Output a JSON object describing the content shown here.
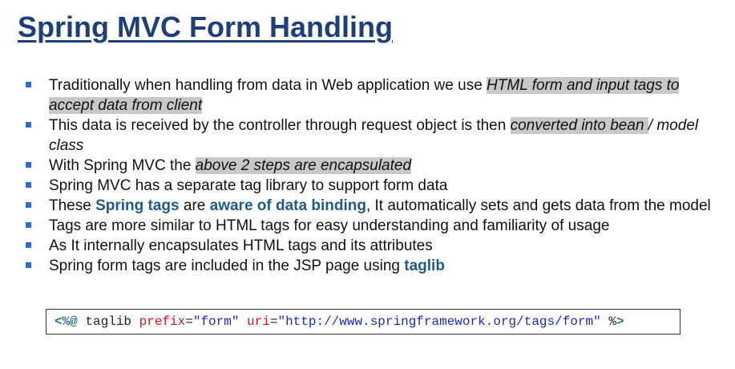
{
  "slide": {
    "title": "Spring MVC Form Handling",
    "bullets": [
      {
        "segments": [
          {
            "text": "Traditionally when handling from data in Web application we use ",
            "style": "plain"
          },
          {
            "text": "HTML form and input tags to accept data from client",
            "style": "highlight"
          }
        ]
      },
      {
        "segments": [
          {
            "text": "This data is received by the controller through request object is then ",
            "style": "plain"
          },
          {
            "text": "converted into bean ",
            "style": "highlight"
          },
          {
            "text": "/ model class",
            "style": "italic"
          }
        ]
      },
      {
        "segments": [
          {
            "text": "With Spring MVC the ",
            "style": "plain"
          },
          {
            "text": "above 2 steps are encapsulated",
            "style": "highlight"
          }
        ]
      },
      {
        "segments": [
          {
            "text": "Spring MVC has a separate tag library to support form data",
            "style": "plain"
          }
        ]
      },
      {
        "segments": [
          {
            "text": "These ",
            "style": "plain"
          },
          {
            "text": "Spring tags",
            "style": "keyword"
          },
          {
            "text": " are ",
            "style": "plain"
          },
          {
            "text": "aware of data binding",
            "style": "keyword"
          },
          {
            "text": ", It automatically sets and gets data from the model",
            "style": "plain"
          }
        ]
      },
      {
        "segments": [
          {
            "text": "Tags are more similar to HTML tags for easy understanding and familiarity of usage",
            "style": "plain"
          }
        ]
      },
      {
        "segments": [
          {
            "text": "As It internally encapsulates HTML tags and its attributes",
            "style": "plain"
          }
        ]
      },
      {
        "segments": [
          {
            "text": "Spring form tags are included in the JSP page using ",
            "style": "plain"
          },
          {
            "text": "taglib",
            "style": "keyword"
          }
        ]
      }
    ],
    "code": {
      "open": "<%@",
      "directive": " taglib ",
      "attr1_name": "prefix",
      "eq1": "=",
      "attr1_value": "\"form\"",
      "attr2_name": " uri",
      "eq2": "=",
      "attr2_value": "\"http://www.springframework.org/tags/form\"",
      "close_pct": " %",
      "close_gt": ">"
    },
    "colors": {
      "title": "#1f3f7a",
      "bullet_marker": "#2e6bd1",
      "highlight_bg": "#c8c8c8",
      "keyword": "#1f5b8a",
      "code_attr": "#d3171b",
      "code_value": "#1b2bb8",
      "code_delim": "#2a6f93"
    }
  }
}
